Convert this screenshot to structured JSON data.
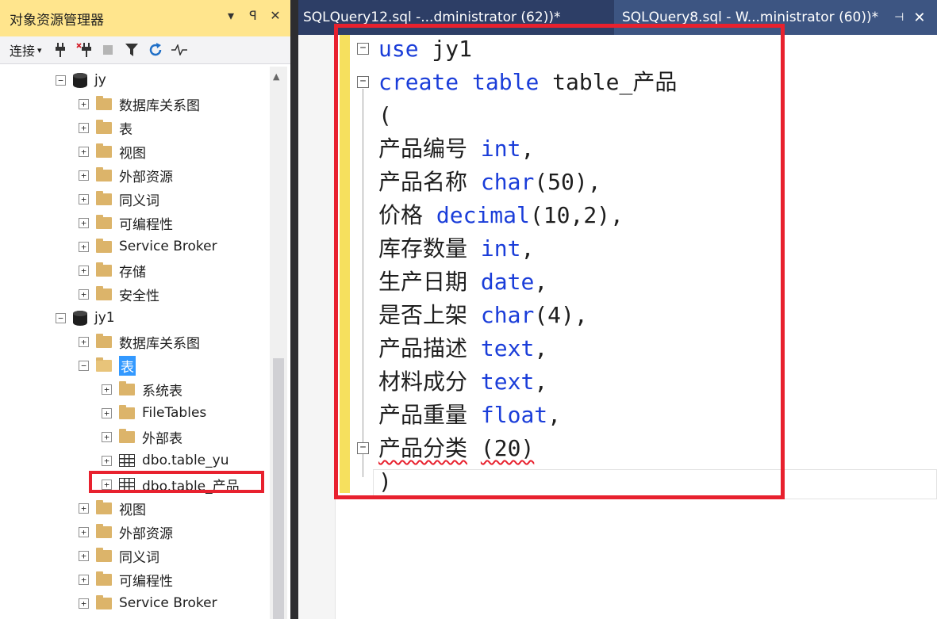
{
  "object_explorer": {
    "title": "对象资源管理器",
    "title_buttons": {
      "dropdown": "▾",
      "pin": "ꟼ",
      "close": "✕"
    },
    "toolbar": {
      "connect": "连接",
      "connect_arrow": "▾",
      "icons": [
        "plug-icon",
        "disconnect-icon",
        "stop-icon",
        "filter-icon",
        "refresh-icon",
        "activity-icon"
      ]
    },
    "tree": [
      {
        "label": "jy",
        "kind": "database",
        "expanded": true,
        "level": 0
      },
      {
        "label": "数据库关系图",
        "kind": "folder",
        "level": 1
      },
      {
        "label": "表",
        "kind": "folder",
        "level": 1
      },
      {
        "label": "视图",
        "kind": "folder",
        "level": 1
      },
      {
        "label": "外部资源",
        "kind": "folder",
        "level": 1
      },
      {
        "label": "同义词",
        "kind": "folder",
        "level": 1
      },
      {
        "label": "可编程性",
        "kind": "folder",
        "level": 1
      },
      {
        "label": "Service Broker",
        "kind": "folder",
        "level": 1
      },
      {
        "label": "存储",
        "kind": "folder",
        "level": 1
      },
      {
        "label": "安全性",
        "kind": "folder",
        "level": 1
      },
      {
        "label": "jy1",
        "kind": "database",
        "expanded": true,
        "level": 0
      },
      {
        "label": "数据库关系图",
        "kind": "folder",
        "level": 1
      },
      {
        "label": "表",
        "kind": "folder",
        "level": 1,
        "expanded": true,
        "selected": true
      },
      {
        "label": "系统表",
        "kind": "folder",
        "level": 2
      },
      {
        "label": "FileTables",
        "kind": "folder",
        "level": 2
      },
      {
        "label": "外部表",
        "kind": "folder",
        "level": 2
      },
      {
        "label": "dbo.table_yu",
        "kind": "table",
        "level": 2
      },
      {
        "label": "dbo.table_产品",
        "kind": "table",
        "level": 2
      },
      {
        "label": "视图",
        "kind": "folder",
        "level": 1
      },
      {
        "label": "外部资源",
        "kind": "folder",
        "level": 1
      },
      {
        "label": "同义词",
        "kind": "folder",
        "level": 1
      },
      {
        "label": "可编程性",
        "kind": "folder",
        "level": 1
      },
      {
        "label": "Service Broker",
        "kind": "folder",
        "level": 1
      },
      {
        "label": "存储",
        "kind": "folder",
        "level": 1
      }
    ]
  },
  "tabs": [
    {
      "label": "SQLQuery12.sql -...dministrator (62))*",
      "active": true
    },
    {
      "label": "SQLQuery8.sql - W...ministrator (60))*",
      "active": false,
      "pin": "⊣",
      "close": "✕"
    }
  ],
  "code": [
    [
      {
        "t": "use",
        "c": "kw"
      },
      {
        "t": " jy1"
      }
    ],
    [
      {
        "t": "create",
        "c": "kw"
      },
      {
        "t": " "
      },
      {
        "t": "table",
        "c": "kw"
      },
      {
        "t": " table_"
      },
      {
        "t": "产品",
        "c": "zh"
      }
    ],
    [
      {
        "t": "("
      }
    ],
    [
      {
        "t": "产品编号",
        "c": "zh"
      },
      {
        "t": " "
      },
      {
        "t": "int",
        "c": "kw"
      },
      {
        "t": ","
      }
    ],
    [
      {
        "t": "产品名称",
        "c": "zh"
      },
      {
        "t": " "
      },
      {
        "t": "char",
        "c": "kw"
      },
      {
        "t": "(50),"
      }
    ],
    [
      {
        "t": "价格",
        "c": "zh"
      },
      {
        "t": " "
      },
      {
        "t": "decimal",
        "c": "kw"
      },
      {
        "t": "(10,2),"
      }
    ],
    [
      {
        "t": "库存数量",
        "c": "zh"
      },
      {
        "t": " "
      },
      {
        "t": "int",
        "c": "kw"
      },
      {
        "t": ","
      }
    ],
    [
      {
        "t": "生产日期",
        "c": "zh"
      },
      {
        "t": " "
      },
      {
        "t": "date",
        "c": "kw"
      },
      {
        "t": ","
      }
    ],
    [
      {
        "t": "是否上架",
        "c": "zh"
      },
      {
        "t": " "
      },
      {
        "t": "char",
        "c": "kw"
      },
      {
        "t": "(4),"
      }
    ],
    [
      {
        "t": "产品描述",
        "c": "zh"
      },
      {
        "t": " "
      },
      {
        "t": "text",
        "c": "kw"
      },
      {
        "t": ","
      }
    ],
    [
      {
        "t": "材料成分",
        "c": "zh"
      },
      {
        "t": " "
      },
      {
        "t": "text",
        "c": "kw"
      },
      {
        "t": ","
      }
    ],
    [
      {
        "t": "产品重量",
        "c": "zh"
      },
      {
        "t": " "
      },
      {
        "t": "float",
        "c": "kw"
      },
      {
        "t": ","
      }
    ],
    [
      {
        "t": "产品分类",
        "c": "zh err"
      },
      {
        "t": " "
      },
      {
        "t": "(20)",
        "c": "err"
      }
    ],
    [
      {
        "t": ")"
      }
    ]
  ],
  "colors": {
    "keyword": "#1a3dd9",
    "highlight": "#e8212e",
    "tab_bar": "#2d3e66",
    "oe_title": "#ffe58d",
    "selection": "#3399ff"
  }
}
